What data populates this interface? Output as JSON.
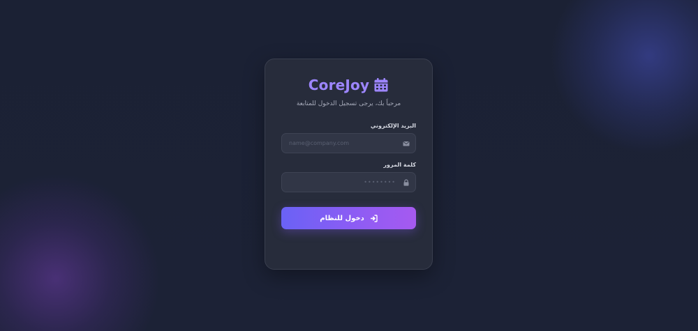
{
  "brand": {
    "name": "CoreJoy",
    "icon": "calendar-icon",
    "color": "#9d86ff"
  },
  "subtitle": "مرحباً بك، يرجى تسجيل الدخول للمتابعة",
  "form": {
    "email": {
      "label": "البريد الإلكتروني",
      "placeholder": "name@company.com",
      "value": "",
      "icon": "envelope-icon"
    },
    "password": {
      "label": "كلمة المرور",
      "placeholder": "••••••••",
      "value": "",
      "icon": "lock-icon"
    },
    "submit": {
      "label": "دخول للنظام",
      "icon": "sign-in-icon"
    }
  },
  "colors": {
    "background": "#1a2033",
    "card": "#272c3b",
    "accent_start": "#6a62f5",
    "accent_end": "#a65af0"
  }
}
